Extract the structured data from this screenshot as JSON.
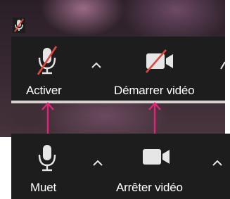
{
  "top_toolbar": {
    "audio_label": "Activer",
    "video_label": "Démarrer vidéo"
  },
  "bottom_toolbar": {
    "audio_label": "Muet",
    "video_label": "Arrêter vidéo"
  },
  "colors": {
    "toolbar_bg": "#1d1d1d",
    "icon": "#e6e6e6",
    "strike": "#e0473f",
    "arrow": "#e2237a"
  }
}
